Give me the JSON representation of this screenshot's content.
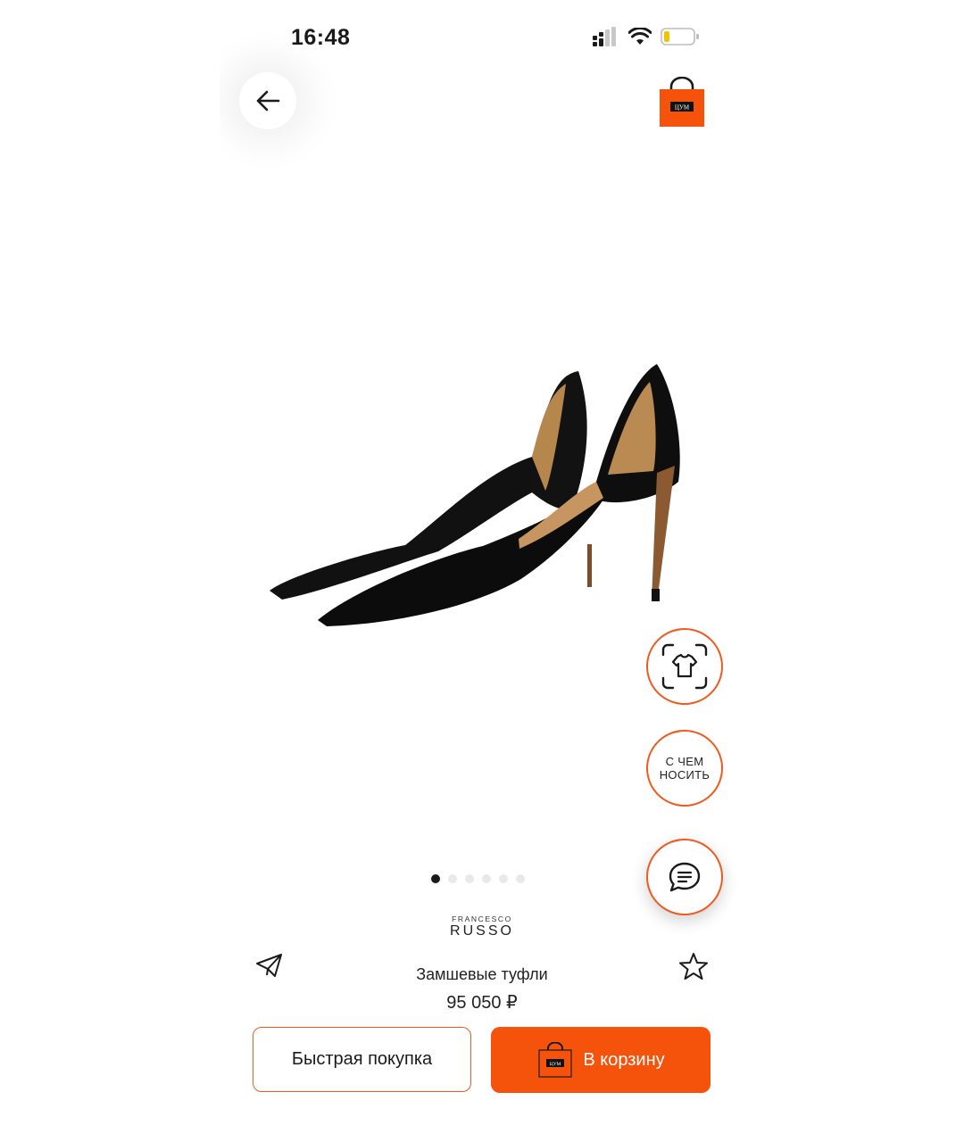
{
  "status_bar": {
    "time": "16:48",
    "icons": [
      "cellular-signal-icon",
      "wifi-icon",
      "battery-icon"
    ]
  },
  "header": {
    "back_icon": "arrow-left-icon",
    "bag_logo_text": "ЦУМ"
  },
  "gallery": {
    "image_subject": "black suede pumps",
    "slide_count": 6,
    "active_index": 0
  },
  "floating_actions": {
    "visual_search_icon": "tshirt-scan-icon",
    "what_to_wear_label": "С ЧЕМ\nНОСИТЬ",
    "chat_icon": "chat-bubble-icon"
  },
  "product": {
    "brand_top": "FRANCESCO",
    "brand_main": "RUSSO",
    "name": "Замшевые туфли",
    "price": "95 050 ₽"
  },
  "actions": {
    "share_icon": "paper-plane-icon",
    "favorite_icon": "star-outline-icon",
    "quick_buy_label": "Быстрая покупка",
    "add_to_cart_label": "В корзину",
    "cart_logo_text": "ЦУМ"
  },
  "colors": {
    "accent": "#f5520c",
    "border_accent": "#f05a1e",
    "text": "#1a1a1a"
  }
}
